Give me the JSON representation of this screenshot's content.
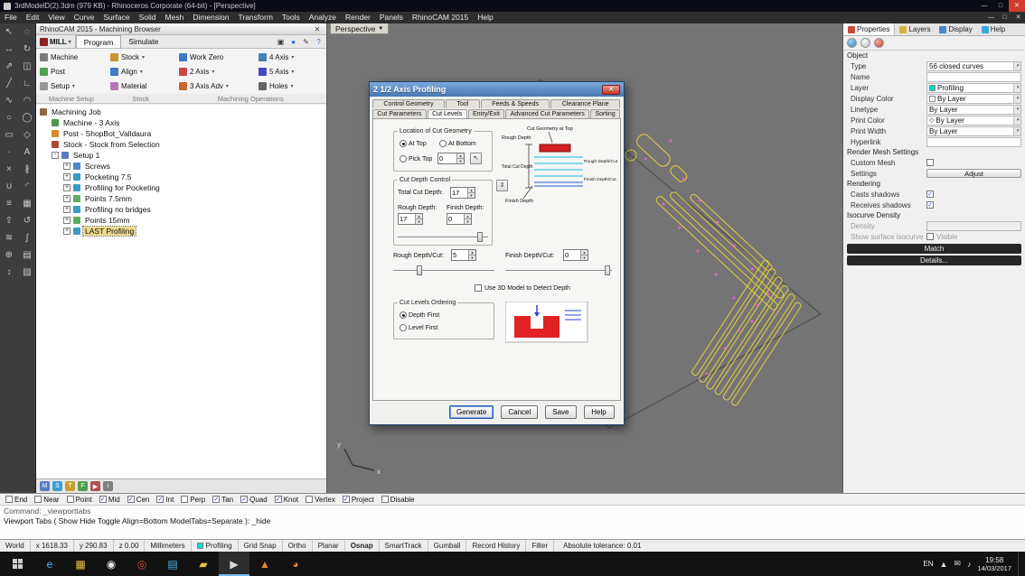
{
  "titlebar": {
    "title": "3rdModelD(2).3dm (979 KB) - Rhinoceros Corporate (64-bit) - [Perspective]"
  },
  "menubar": {
    "items": [
      "File",
      "Edit",
      "View",
      "Curve",
      "Surface",
      "Solid",
      "Mesh",
      "Dimension",
      "Transform",
      "Tools",
      "Analyze",
      "Render",
      "Panels",
      "RhinoCAM 2015",
      "Help"
    ]
  },
  "tool_palette": {
    "icons": [
      {
        "name": "select-tool-icon",
        "glyph": "↖"
      },
      {
        "name": "lasso-tool-icon",
        "glyph": "◌"
      },
      {
        "name": "move-tool-icon",
        "glyph": "↔"
      },
      {
        "name": "rotate-tool-icon",
        "glyph": "↻"
      },
      {
        "name": "scale-tool-icon",
        "glyph": "⇗"
      },
      {
        "name": "mirror-tool-icon",
        "glyph": "◫"
      },
      {
        "name": "line-tool-icon",
        "glyph": "╱"
      },
      {
        "name": "polyline-tool-icon",
        "glyph": "∟"
      },
      {
        "name": "curve-tool-icon",
        "glyph": "∿"
      },
      {
        "name": "arc-tool-icon",
        "glyph": "◠"
      },
      {
        "name": "circle-tool-icon",
        "glyph": "○"
      },
      {
        "name": "ellipse-tool-icon",
        "glyph": "◯"
      },
      {
        "name": "rectangle-tool-icon",
        "glyph": "▭"
      },
      {
        "name": "polygon-tool-icon",
        "glyph": "◇"
      },
      {
        "name": "point-tool-icon",
        "glyph": "∙"
      },
      {
        "name": "text-tool-icon",
        "glyph": "A"
      },
      {
        "name": "trim-tool-icon",
        "glyph": "×"
      },
      {
        "name": "split-tool-icon",
        "glyph": "∦"
      },
      {
        "name": "join-tool-icon",
        "glyph": "∪"
      },
      {
        "name": "fillet-tool-icon",
        "glyph": "◜"
      },
      {
        "name": "offset-tool-icon",
        "glyph": "≡"
      },
      {
        "name": "array-tool-icon",
        "glyph": "▦"
      },
      {
        "name": "extrude-tool-icon",
        "glyph": "⇧"
      },
      {
        "name": "revolve-tool-icon",
        "glyph": "↺"
      },
      {
        "name": "loft-tool-icon",
        "glyph": "≋"
      },
      {
        "name": "sweep-tool-icon",
        "glyph": "∫"
      },
      {
        "name": "boolean-tool-icon",
        "glyph": "⊕"
      },
      {
        "name": "mesh-tool-icon",
        "glyph": "▤"
      },
      {
        "name": "dimension-tool-icon",
        "glyph": "↕"
      },
      {
        "name": "hatch-tool-icon",
        "glyph": "▨"
      }
    ]
  },
  "browser": {
    "header_title": "RhinoCAM 2015 - Machining Browser",
    "mill_label": "MILL",
    "tabs": [
      {
        "label": "Program",
        "active": true
      },
      {
        "label": "Simulate",
        "active": false
      }
    ],
    "header_icons": [
      {
        "name": "dock-icon",
        "glyph": "▣"
      },
      {
        "name": "world-icon",
        "glyph": "●",
        "color": "#2a6adb"
      },
      {
        "name": "preferences-icon",
        "glyph": "✎"
      },
      {
        "name": "help-icon",
        "glyph": "?",
        "color": "#2a6adb"
      }
    ],
    "ribbon": [
      {
        "label": "Machine",
        "color": "#7a7a7a",
        "arrow": false
      },
      {
        "label": "Stock",
        "color": "#c89632",
        "arrow": true
      },
      {
        "label": "Work Zero",
        "color": "#3c78c8",
        "arrow": false
      },
      {
        "label": "4 Axis",
        "color": "#4682b4",
        "arrow": true
      },
      {
        "label": "Post",
        "color": "#50a050",
        "arrow": false
      },
      {
        "label": "Align",
        "color": "#4678c8",
        "arrow": true
      },
      {
        "label": "2 Axis",
        "color": "#c84646",
        "arrow": true
      },
      {
        "label": "5 Axis",
        "color": "#4646c8",
        "arrow": true
      },
      {
        "label": "Setup",
        "color": "#969696",
        "arrow": true
      },
      {
        "label": "Material",
        "color": "#b478b4",
        "arrow": false
      },
      {
        "label": "3 Axis Adv",
        "color": "#c86432",
        "arrow": true
      },
      {
        "label": "Holes",
        "color": "#646464",
        "arrow": true
      }
    ],
    "groups": {
      "machine_setup": "Machine Setup",
      "stock": "Stock",
      "machining_operations": "Machining Operations"
    },
    "tree": [
      {
        "label": "Machining Job",
        "pad": 0,
        "exp": "",
        "icon": "#8a6a3a",
        "selected": false
      },
      {
        "label": "Machine - 3 Axis",
        "pad": 1,
        "exp": "",
        "icon": "#4a9a4a",
        "selected": false
      },
      {
        "label": "Post - ShopBot_Valldaura",
        "pad": 1,
        "exp": "",
        "icon": "#d88a2a",
        "selected": false
      },
      {
        "label": "Stock - Stock from Selection",
        "pad": 1,
        "exp": "",
        "icon": "#a84a3a",
        "selected": false
      },
      {
        "label": "Setup 1",
        "pad": 1,
        "exp": "-",
        "icon": "#5a7ac8",
        "selected": false
      },
      {
        "label": "Screws",
        "pad": 2,
        "exp": "+",
        "icon": "#4a88c8",
        "selected": false
      },
      {
        "label": "Pocketing 7.5",
        "pad": 2,
        "exp": "+",
        "icon": "#3a9ac8",
        "selected": false
      },
      {
        "label": "Profiling for Pocketing",
        "pad": 2,
        "exp": "+",
        "icon": "#3a9ac8",
        "selected": false
      },
      {
        "label": "Points 7.5mm",
        "pad": 2,
        "exp": "+",
        "icon": "#5ab05a",
        "selected": false
      },
      {
        "label": "Profiling no bridges",
        "pad": 2,
        "exp": "+",
        "icon": "#3a9ac8",
        "selected": false
      },
      {
        "label": "Points 15mm",
        "pad": 2,
        "exp": "+",
        "icon": "#5ab05a",
        "selected": false
      },
      {
        "label": "LAST Profiling",
        "pad": 2,
        "exp": "+",
        "icon": "#3a9ac8",
        "selected": true
      }
    ],
    "footer_icons": [
      {
        "name": "machine-visibility-icon",
        "glyph": "M",
        "color": "#5a7ac8"
      },
      {
        "name": "stock-visibility-icon",
        "glyph": "S",
        "color": "#3aa0d0"
      },
      {
        "name": "toolpath-visibility-icon",
        "glyph": "T",
        "color": "#c8a032"
      },
      {
        "name": "fixture-visibility-icon",
        "glyph": "F",
        "color": "#50a050"
      },
      {
        "name": "simulate-icon",
        "glyph": "▶",
        "color": "#b05050"
      },
      {
        "name": "info-icon",
        "glyph": "i",
        "color": "#808080"
      }
    ]
  },
  "viewport": {
    "label": "Perspective",
    "axis_x": "x",
    "axis_y": "y"
  },
  "dialog": {
    "title": "2 1/2 Axis Profiling",
    "tabs_row1": [
      {
        "label": "Control Geometry"
      },
      {
        "label": "Tool"
      },
      {
        "label": "Feeds & Speeds"
      },
      {
        "label": "Clearance Plane"
      }
    ],
    "tabs_row2": [
      {
        "label": "Cut Parameters"
      },
      {
        "label": "Cut Levels",
        "active": true
      },
      {
        "label": "Entry/Exit"
      },
      {
        "label": "Advanced Cut Parameters"
      },
      {
        "label": "Sorting"
      }
    ],
    "location": {
      "title": "Location of Cut Geometry",
      "at_top": "At Top",
      "at_bottom": "At Bottom",
      "pick_top": "Pick Top",
      "pick_top_value": "0"
    },
    "depth": {
      "title": "Cut Depth Control",
      "total_label": "Total Cut Depth:",
      "total_value": "17",
      "rough_label": "Rough Depth:",
      "rough_value": "17",
      "finish_label": "Finish Depth:",
      "finish_value": "0",
      "rough_cut_label": "Rough Depth/Cut:",
      "rough_cut_value": "5",
      "finish_cut_label": "Finish Depth/Cut:",
      "finish_cut_value": "0"
    },
    "diagram": {
      "cut_geometry_top": "Cut Geometry at Top",
      "rough_depth": "Rough Depth",
      "total_cut_depth": "Total Cut Depth",
      "finish_depth": "Finish Depth",
      "rough_depth_cut": "Rough Depth/Cut",
      "finish_depth_cut": "Finish Depth/Cut"
    },
    "detect_label": "Use 3D Model to Detect Depth",
    "ordering": {
      "title": "Cut Levels Ordering",
      "depth_first": "Depth First",
      "level_first": "Level First"
    },
    "buttons": {
      "generate": "Generate",
      "cancel": "Cancel",
      "save": "Save",
      "help": "Help"
    }
  },
  "props": {
    "tabs": [
      {
        "label": "Properties",
        "active": true,
        "color": "#c84a3a"
      },
      {
        "label": "Layers",
        "active": false,
        "color": "#d8b23a"
      },
      {
        "label": "Display",
        "active": false,
        "color": "#4a86c8"
      },
      {
        "label": "Help",
        "active": false,
        "color": "#38a8d8"
      }
    ],
    "object_header": "Object",
    "rows": {
      "type_label": "Type",
      "type_value": "56 closed curves",
      "name_label": "Name",
      "layer_label": "Layer",
      "layer_value": "Profiling",
      "layer_color": "#00d8d8",
      "display_color_label": "Display Color",
      "display_color_value": "By Layer",
      "linetype_label": "Linetype",
      "linetype_value": "By Layer",
      "print_color_label": "Print Color",
      "print_color_value": "By Layer",
      "print_width_label": "Print Width",
      "print_width_value": "By Layer",
      "hyperlink_label": "Hyperlink"
    },
    "render_mesh_header": "Render Mesh Settings",
    "custom_mesh_label": "Custom Mesh",
    "settings_label": "Settings",
    "adjust_button": "Adjust",
    "rendering_header": "Rendering",
    "casts_label": "Casts shadows",
    "receives_label": "Receives shadows",
    "isocurve_header": "Isocurve Density",
    "density_label": "Density",
    "show_isocurve_label": "Show surface isocurve",
    "visible_label": "Visible",
    "match_button": "Match",
    "details_button": "Details..."
  },
  "osnap": {
    "items": [
      {
        "label": "End",
        "checked": false
      },
      {
        "label": "Near",
        "checked": false
      },
      {
        "label": "Point",
        "checked": false
      },
      {
        "label": "Mid",
        "checked": true
      },
      {
        "label": "Cen",
        "checked": true
      },
      {
        "label": "Int",
        "checked": true
      },
      {
        "label": "Perp",
        "checked": false
      },
      {
        "label": "Tan",
        "checked": true
      },
      {
        "label": "Quad",
        "checked": true
      },
      {
        "label": "Knot",
        "checked": true
      },
      {
        "label": "Vertex",
        "checked": false
      },
      {
        "label": "Project",
        "checked": true
      },
      {
        "label": "Disable",
        "checked": false
      }
    ]
  },
  "command": {
    "line1": "Command: _viewporttabs",
    "line2": "Viewport Tabs ( Show Hide Toggle Align=Bottom ModelTabs=Separate ): _hide"
  },
  "statusbar": {
    "cplane": "World",
    "x": "x 1618.33",
    "y": "y 290.83",
    "z": "z 0.00",
    "units": "Millimeters",
    "layer": "Profiling",
    "layer_color": "#00d8d8",
    "toggles": [
      {
        "label": "Grid Snap",
        "active": false
      },
      {
        "label": "Ortho",
        "active": false
      },
      {
        "label": "Planar",
        "active": false
      },
      {
        "label": "Osnap",
        "active": true
      },
      {
        "label": "SmartTrack",
        "active": false
      },
      {
        "label": "Gumball",
        "active": false
      },
      {
        "label": "Record History",
        "active": false
      },
      {
        "label": "Filter",
        "active": false
      }
    ],
    "tolerance": "Absolute tolerance: 0.01"
  },
  "taskbar": {
    "icons": [
      {
        "name": "edge-icon",
        "glyph": "e",
        "color": "#45b6e8",
        "active": false
      },
      {
        "name": "file-explorer-icon",
        "glyph": "▦",
        "color": "#e8c24b",
        "active": false
      },
      {
        "name": "chrome-icon",
        "glyph": "◉",
        "color": "#e8e8e8",
        "active": false
      },
      {
        "name": "opera-icon",
        "glyph": "◎",
        "color": "#e04b3a",
        "active": false
      },
      {
        "name": "store-icon",
        "glyph": "▤",
        "color": "#4bb6e8",
        "active": false
      },
      {
        "name": "folder-icon",
        "glyph": "▰",
        "color": "#e8c24b",
        "active": false
      },
      {
        "name": "media-player-icon",
        "glyph": "▶",
        "color": "#d8d8d8",
        "active": true
      },
      {
        "name": "vlc-icon",
        "glyph": "▲",
        "color": "#e8862f",
        "active": false
      },
      {
        "name": "firefox-icon",
        "glyph": "◕",
        "color": "#e8822f",
        "active": false
      }
    ],
    "tray": {
      "lang": "EN",
      "time": "19:58",
      "date": "14/03/2017"
    }
  }
}
